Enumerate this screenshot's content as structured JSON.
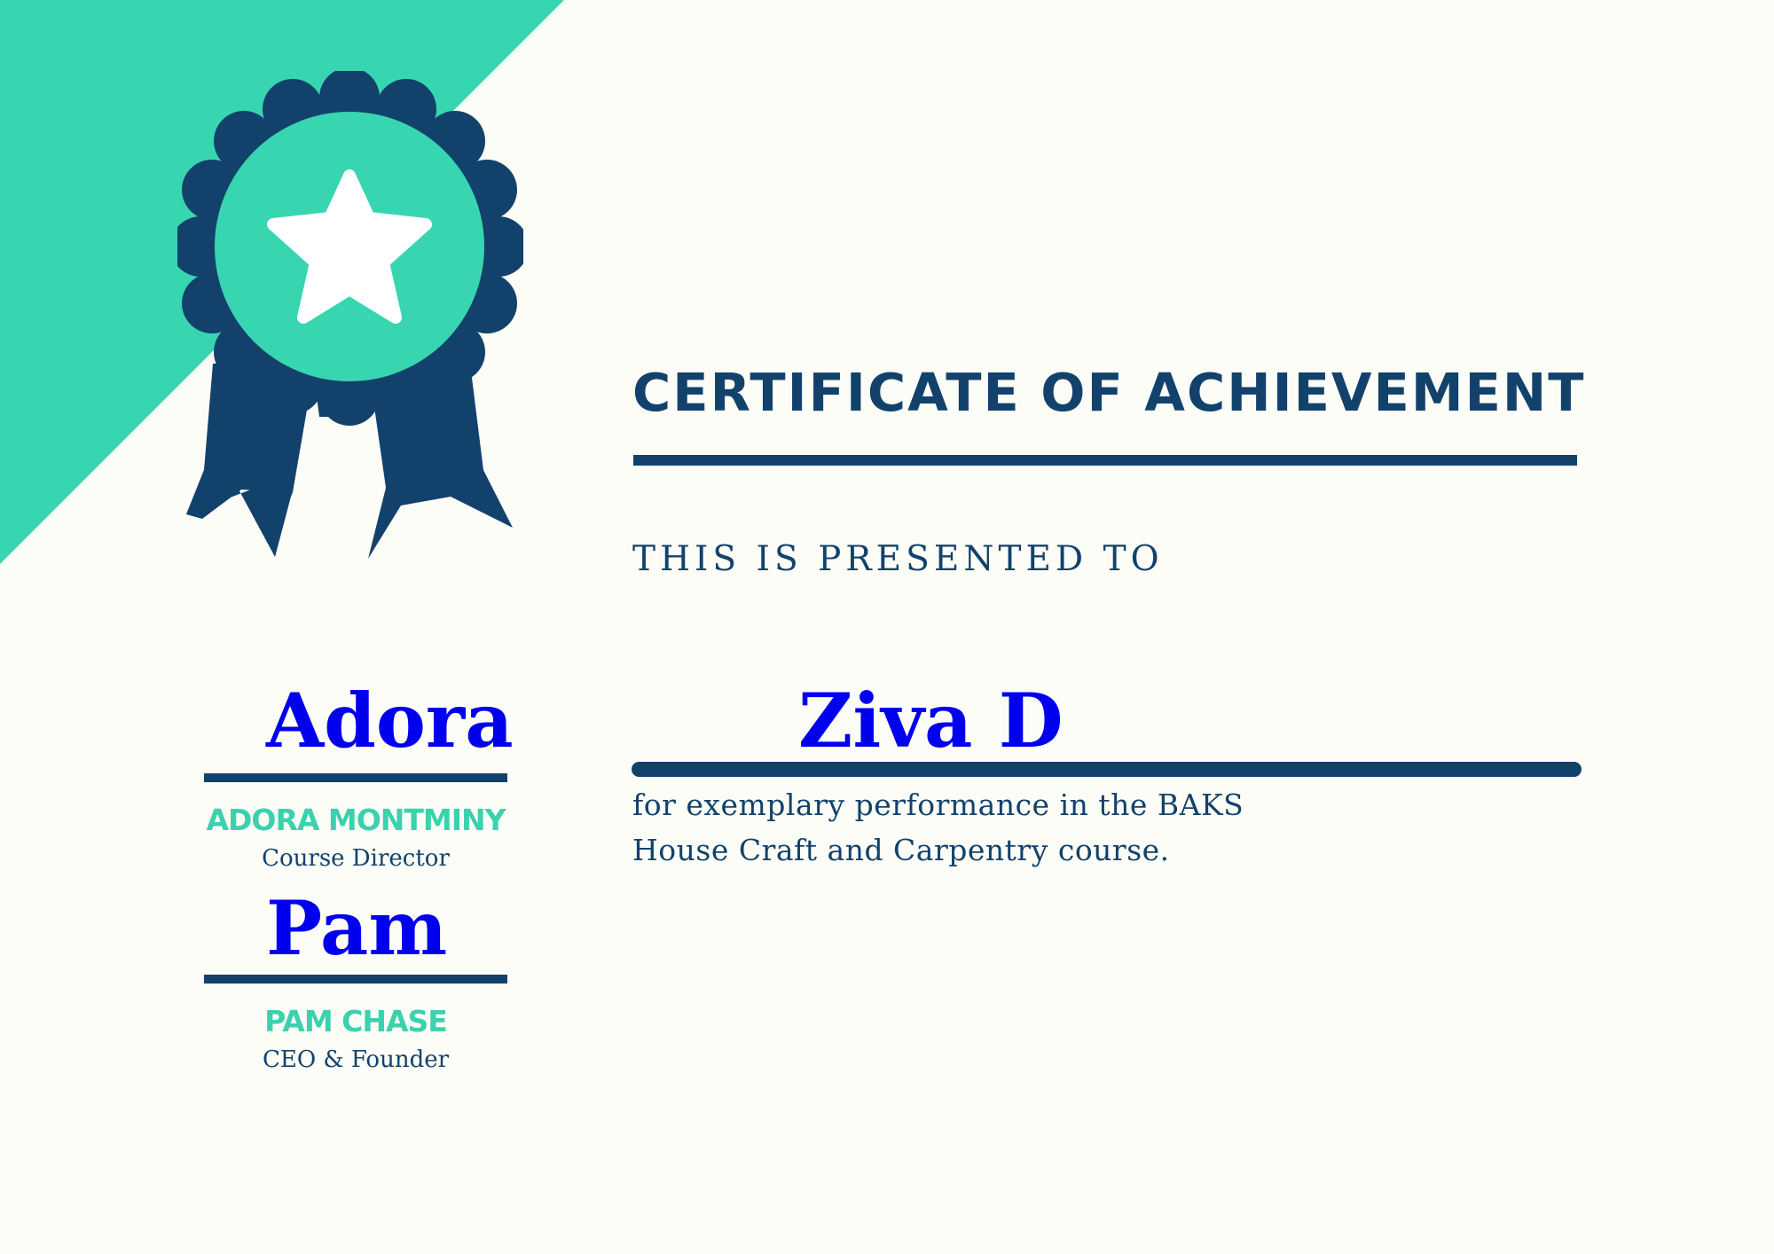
{
  "certificate": {
    "title": "CERTIFICATE OF ACHIEVEMENT",
    "presented_line": "THIS IS PRESENTED TO",
    "recipient_name": "Ziva D",
    "description": "for exemplary performance in the BAKS House Craft and Carpentry course."
  },
  "signatures": [
    {
      "signature": "Adora",
      "name": "ADORA MONTMINY",
      "role": "Course Director"
    },
    {
      "signature": "Pam",
      "name": "PAM CHASE",
      "role": "CEO & Founder"
    }
  ],
  "colors": {
    "background": "#fdfdf7",
    "navy": "#12426c",
    "teal": "#38d6b0",
    "signature_blue": "#0000ee"
  },
  "icons": {
    "badge": "award-ribbon-icon",
    "badge_star": "star-icon"
  }
}
